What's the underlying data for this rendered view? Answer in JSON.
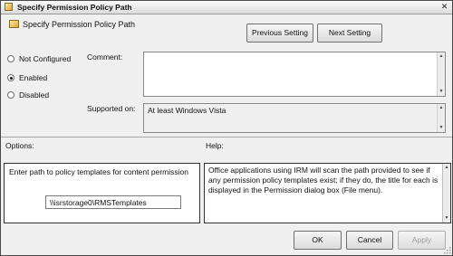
{
  "window": {
    "title": "Specify Permission Policy Path",
    "close_glyph": "✕"
  },
  "header": {
    "title": "Specify Permission Policy Path",
    "previous_label": "Previous Setting",
    "next_label": "Next Setting"
  },
  "state": {
    "options": [
      {
        "label": "Not Configured",
        "selected": false
      },
      {
        "label": "Enabled",
        "selected": true
      },
      {
        "label": "Disabled",
        "selected": false
      }
    ]
  },
  "comment": {
    "label": "Comment:",
    "value": ""
  },
  "supported": {
    "label": "Supported on:",
    "value": "At least Windows Vista"
  },
  "options_section": {
    "label": "Options:",
    "prompt": "Enter path to policy templates for content permission",
    "path_value": "\\\\isrstorage0\\RMSTemplates"
  },
  "help_section": {
    "label": "Help:",
    "text": "Office applications using IRM will scan the path provided to see if any permission policy templates exist; if they do, the title for each is displayed in the Permission dialog box (File menu)."
  },
  "footer": {
    "ok_label": "OK",
    "cancel_label": "Cancel",
    "apply_label": "Apply"
  },
  "icons": {
    "title": "policy-icon",
    "header": "policy-icon",
    "scroll_up": "▲",
    "scroll_down": "▼"
  }
}
